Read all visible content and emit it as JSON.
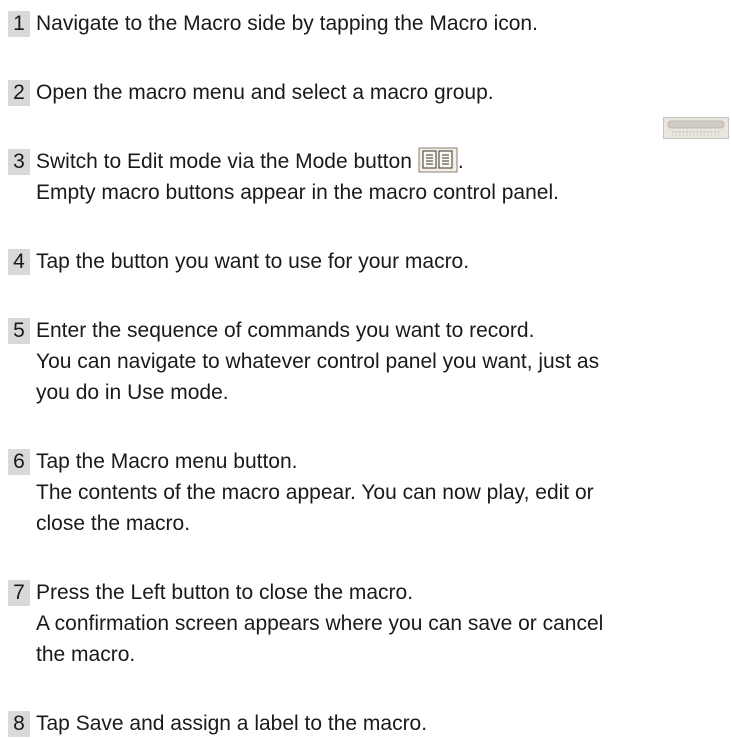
{
  "steps": [
    {
      "number": "1",
      "lines": [
        "Navigate to the Macro side by tapping the Macro icon."
      ]
    },
    {
      "number": "2",
      "lines": [
        "Open the macro menu and select a macro group."
      ]
    },
    {
      "number": "3",
      "lines": [
        "Switch to Edit mode via the Mode button",
        "Empty macro buttons appear in the macro control panel."
      ],
      "suffix": "."
    },
    {
      "number": "4",
      "lines": [
        "Tap the button you want to use for your macro."
      ]
    },
    {
      "number": "5",
      "lines": [
        "Enter the sequence of commands you want to record.",
        "You can navigate to whatever control panel you want, just as",
        "you do in Use mode."
      ]
    },
    {
      "number": "6",
      "lines": [
        "Tap the Macro menu button.",
        "The contents of the macro appear. You can now play, edit or",
        "close the macro."
      ]
    },
    {
      "number": "7",
      "lines": [
        "Press the Left button to close the macro.",
        "A confirmation screen appears where you can save or cancel",
        "the macro."
      ]
    },
    {
      "number": "8",
      "lines": [
        "Tap Save and assign a label to the macro."
      ]
    }
  ],
  "icons": {
    "mode_button": "mode-button-icon",
    "corner_thumbnail": "button-thumbnail-icon"
  }
}
